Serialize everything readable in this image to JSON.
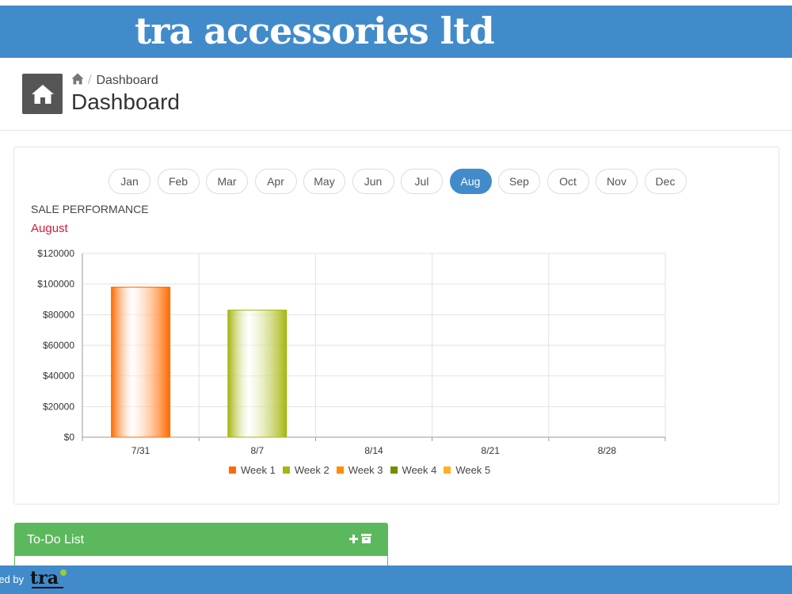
{
  "brand": {
    "name": "tra accessories ltd"
  },
  "breadcrumb": {
    "home_icon": "home-icon",
    "current": "Dashboard"
  },
  "page": {
    "title": "Dashboard",
    "icon": "home-icon"
  },
  "months": [
    "Jan",
    "Feb",
    "Mar",
    "Apr",
    "May",
    "Jun",
    "Jul",
    "Aug",
    "Sep",
    "Oct",
    "Nov",
    "Dec"
  ],
  "active_month": "Aug",
  "sales": {
    "title": "SALE PERFORMANCE",
    "month_label": "August"
  },
  "colors": {
    "accent": "#428bca",
    "success": "#5cb85c",
    "month_label": "#d9183b"
  },
  "chart_data": {
    "type": "bar",
    "categories": [
      "7/31",
      "8/7",
      "8/14",
      "8/21",
      "8/28"
    ],
    "values": [
      98000,
      83000,
      0,
      0,
      0
    ],
    "bar_colors": [
      "#ff6a00",
      "#a6b510",
      "#ff8c00",
      "#6e8f00",
      "#ffb020"
    ],
    "legend": [
      {
        "label": "Week 1",
        "color": "#ff6a00"
      },
      {
        "label": "Week 2",
        "color": "#a6b510"
      },
      {
        "label": "Week 3",
        "color": "#ff8c00"
      },
      {
        "label": "Week 4",
        "color": "#6e8f00"
      },
      {
        "label": "Week 5",
        "color": "#ffb020"
      }
    ],
    "y_ticks": [
      "$0",
      "$20000",
      "$40000",
      "$60000",
      "$80000",
      "$100000",
      "$120000"
    ],
    "ylim": [
      0,
      120000
    ],
    "grid": true,
    "legend_position": "bottom"
  },
  "todo": {
    "title": "To-Do List",
    "add_icon": "plus-icon",
    "archive_icon": "archive-icon"
  },
  "footer": {
    "powered_by": "red by",
    "logo_text": "tra"
  }
}
